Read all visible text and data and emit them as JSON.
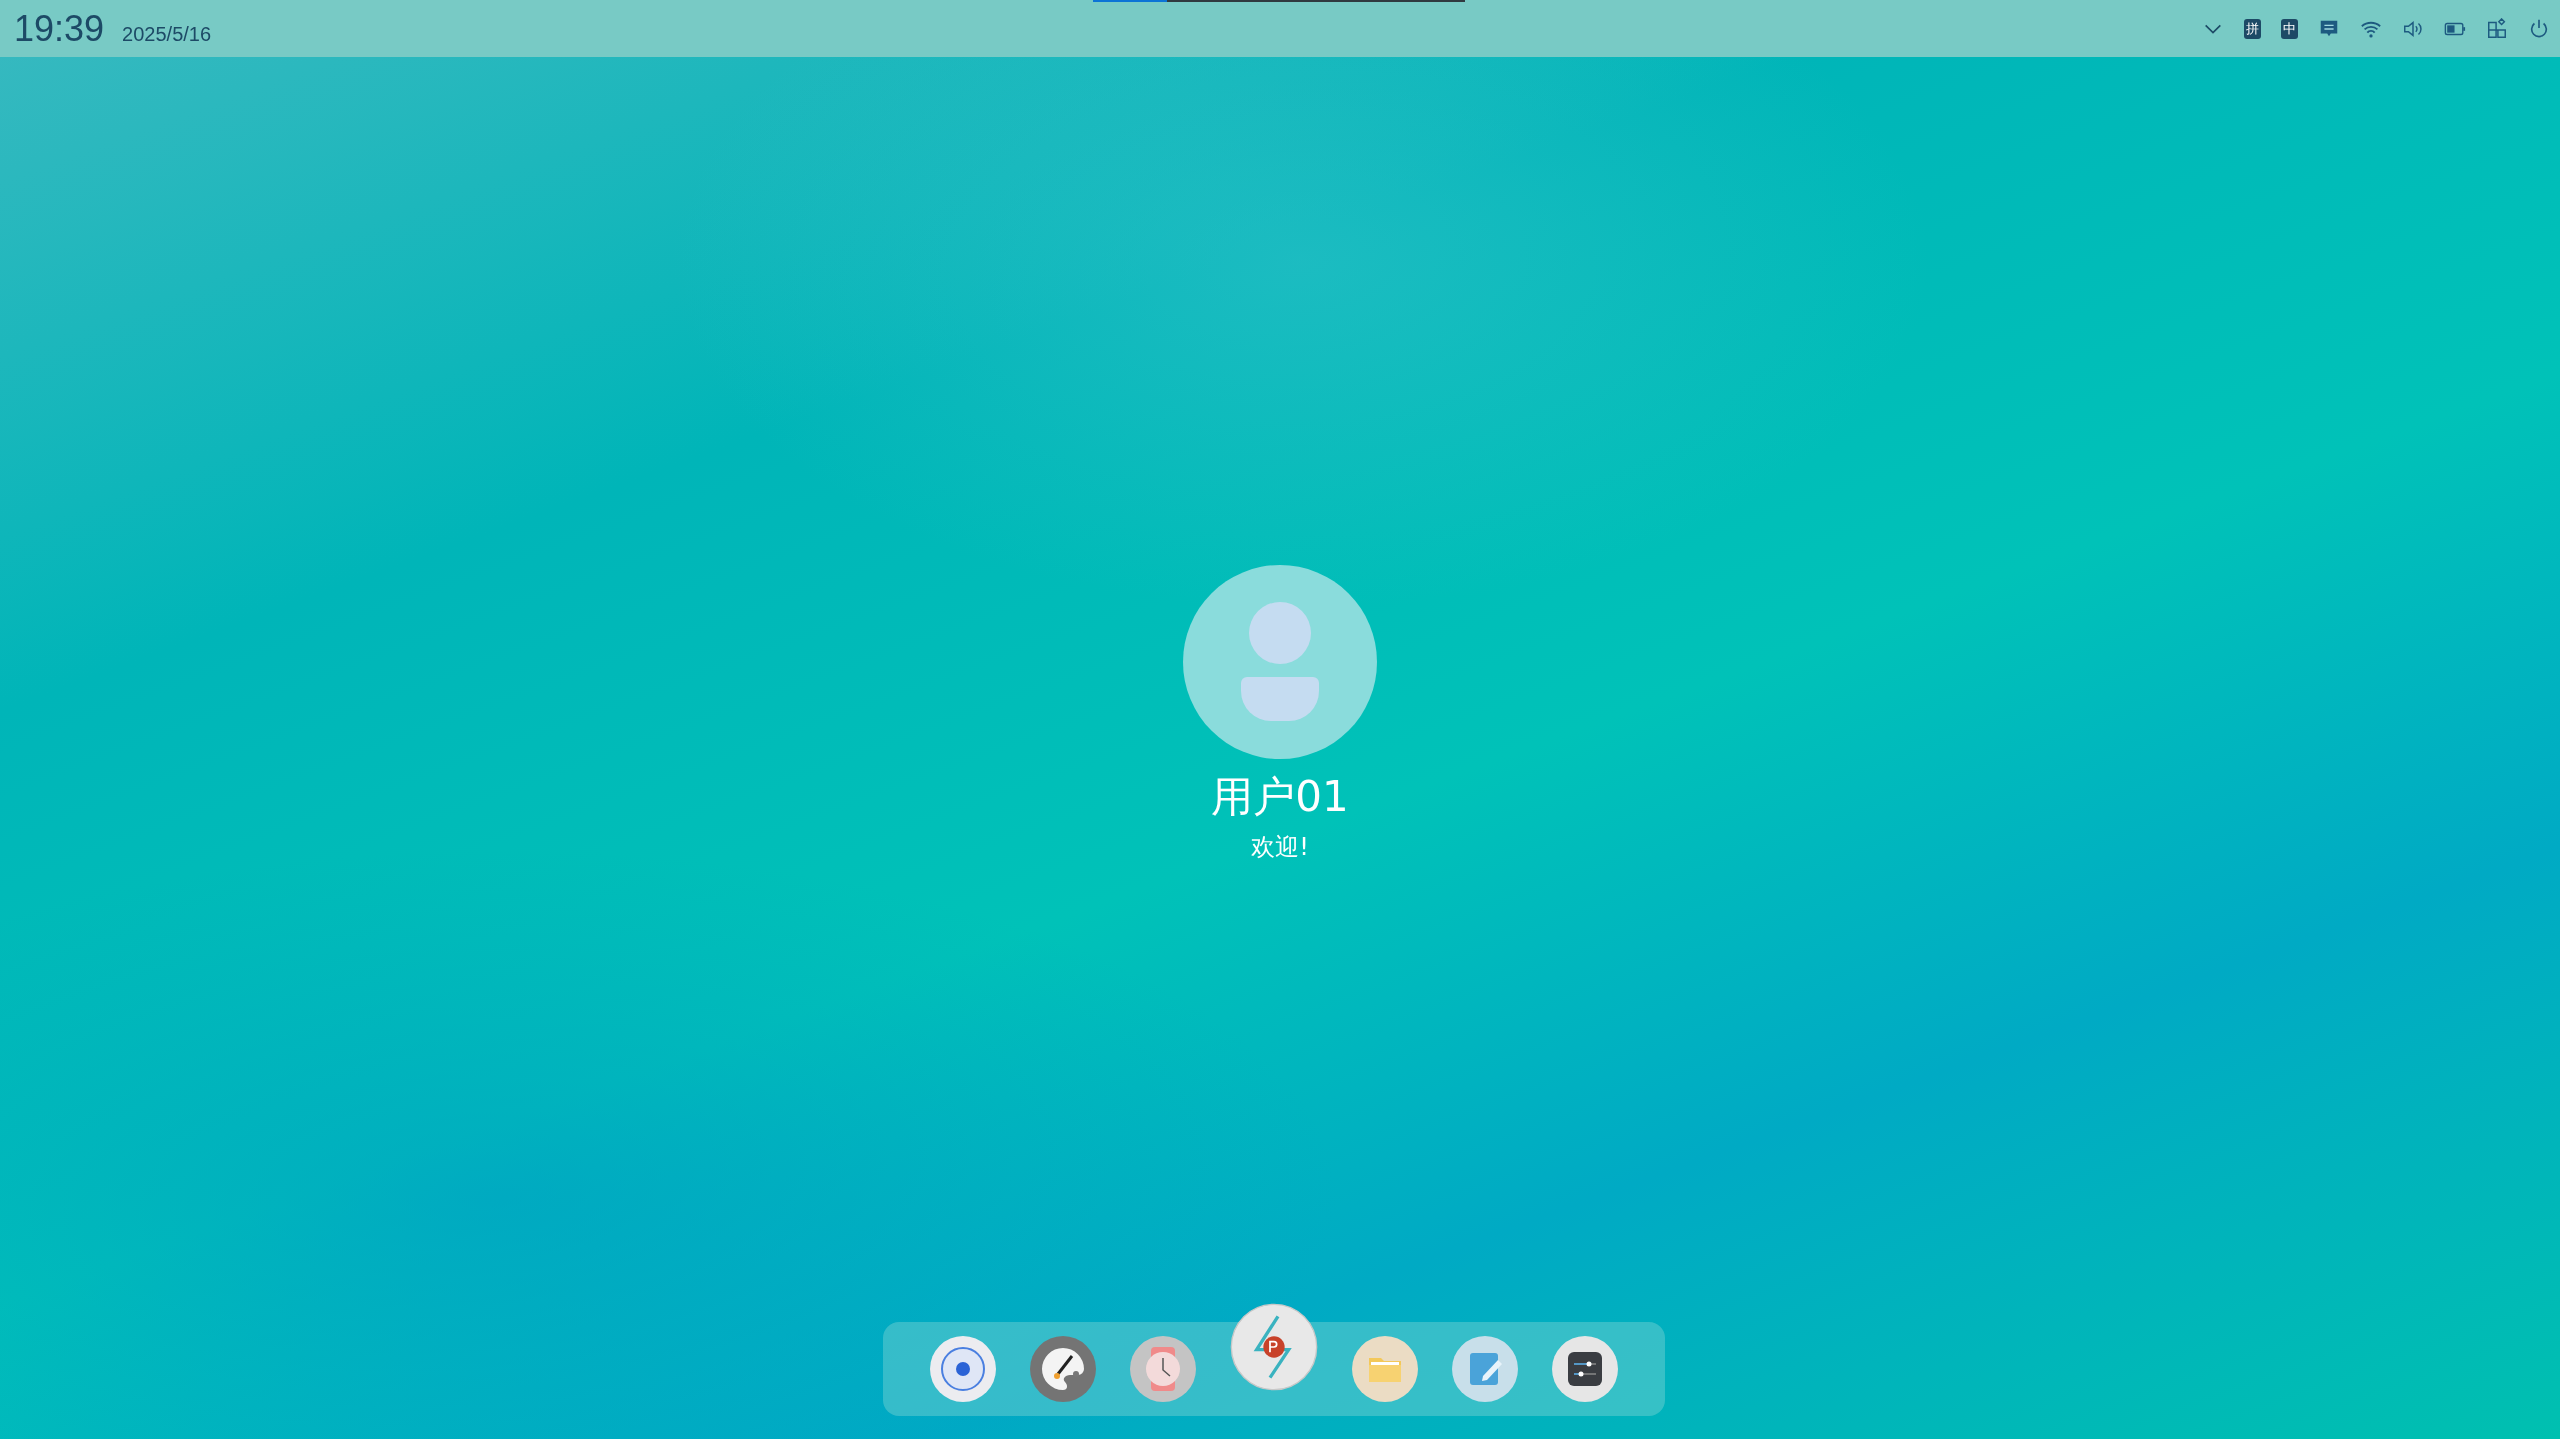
{
  "status_bar": {
    "time": "19:39",
    "date": "2025/5/16",
    "input_badges": [
      "拼",
      "中"
    ]
  },
  "top_indicator": {
    "level": 0.2
  },
  "login": {
    "user_name": "用户01",
    "greeting": "欢迎!"
  },
  "dock": {
    "apps": [
      {
        "kind": "browser",
        "selected": false
      },
      {
        "kind": "paint",
        "selected": false
      },
      {
        "kind": "clock",
        "selected": false
      },
      {
        "kind": "presentation",
        "selected": true
      },
      {
        "kind": "files",
        "selected": false
      },
      {
        "kind": "notes",
        "selected": false
      },
      {
        "kind": "settings",
        "selected": false
      }
    ]
  }
}
